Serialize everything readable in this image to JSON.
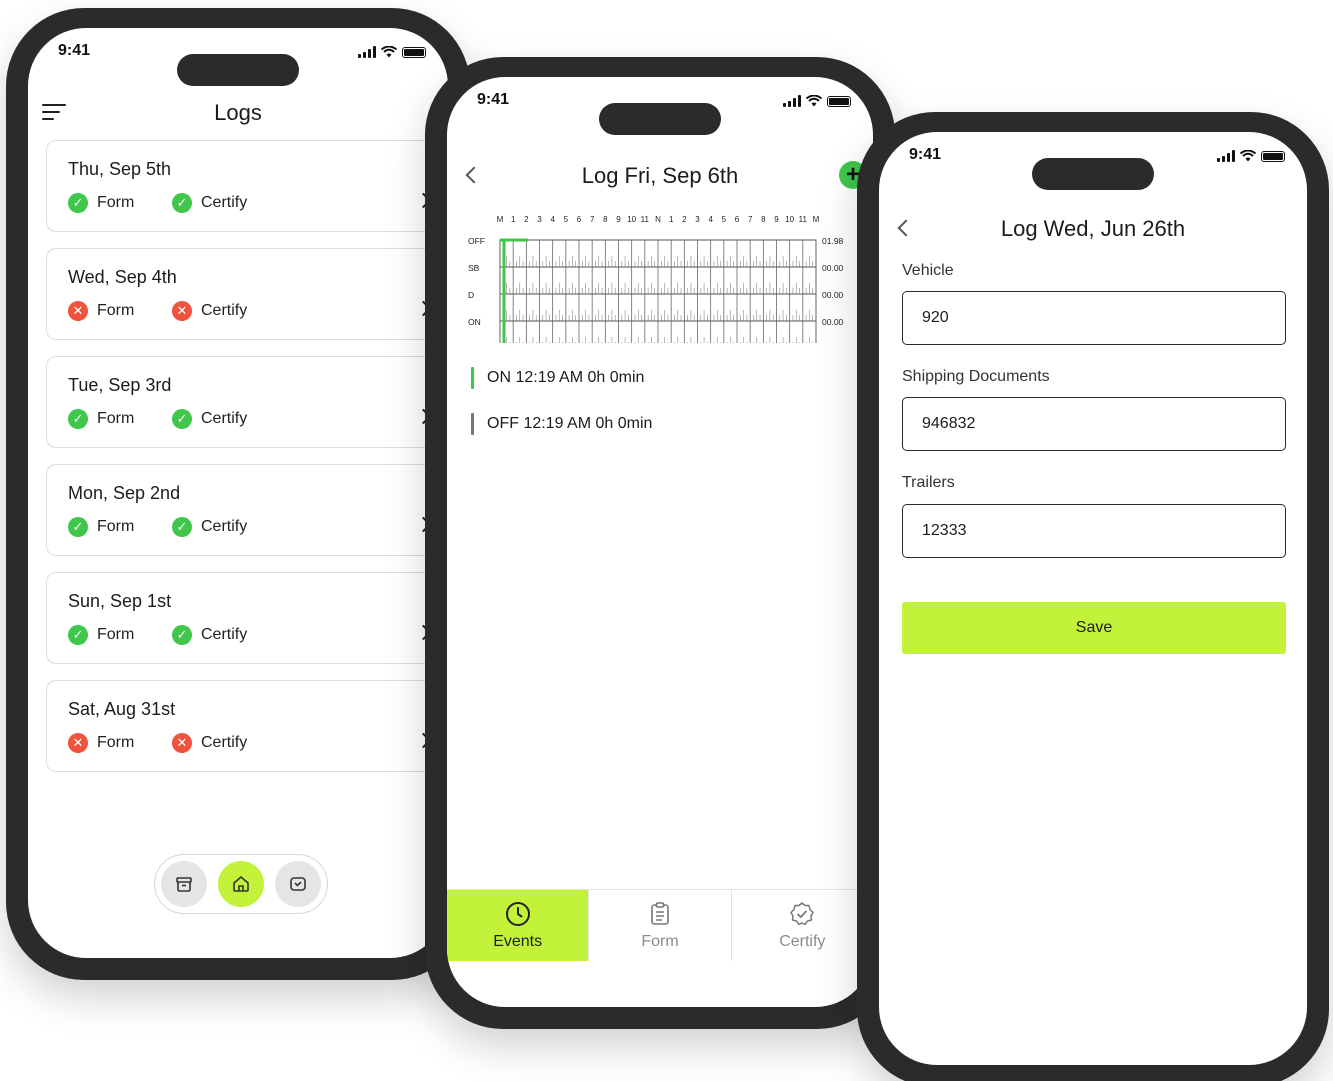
{
  "status_time": "9:41",
  "phone1": {
    "title": "Logs",
    "logs": [
      {
        "date": "Thu, Sep 5th",
        "form": "Form",
        "form_ok": true,
        "certify": "Certify",
        "certify_ok": true
      },
      {
        "date": "Wed, Sep 4th",
        "form": "Form",
        "form_ok": false,
        "certify": "Certify",
        "certify_ok": false
      },
      {
        "date": "Tue, Sep 3rd",
        "form": "Form",
        "form_ok": true,
        "certify": "Certify",
        "certify_ok": true
      },
      {
        "date": "Mon, Sep 2nd",
        "form": "Form",
        "form_ok": true,
        "certify": "Certify",
        "certify_ok": true
      },
      {
        "date": "Sun, Sep 1st",
        "form": "Form",
        "form_ok": true,
        "certify": "Certify",
        "certify_ok": true
      },
      {
        "date": "Sat, Aug 31st",
        "form": "Form",
        "form_ok": false,
        "certify": "Certify",
        "certify_ok": false
      }
    ],
    "dock": [
      {
        "icon": "archive-icon",
        "active": false
      },
      {
        "icon": "home-icon",
        "active": true
      },
      {
        "icon": "inbox-icon",
        "active": false
      }
    ]
  },
  "phone2": {
    "title": "Log Fri, Sep 6th",
    "chart": {
      "hours": [
        "M",
        "1",
        "2",
        "3",
        "4",
        "5",
        "6",
        "7",
        "8",
        "9",
        "10",
        "11",
        "N",
        "1",
        "2",
        "3",
        "4",
        "5",
        "6",
        "7",
        "8",
        "9",
        "10",
        "11",
        "M"
      ],
      "rows": [
        {
          "label": "OFF",
          "total": "01.98"
        },
        {
          "label": "SB",
          "total": "00.00"
        },
        {
          "label": "D",
          "total": "00.00"
        },
        {
          "label": "ON",
          "total": "00.00"
        }
      ]
    },
    "events": [
      {
        "text": "ON 12:19 AM 0h 0min",
        "color": "#3fc64b"
      },
      {
        "text": "OFF 12:19 AM 0h 0min",
        "color": "#777777"
      }
    ],
    "tabs": [
      {
        "label": "Events",
        "icon": "clock-icon",
        "active": true
      },
      {
        "label": "Form",
        "icon": "clipboard-icon",
        "active": false
      },
      {
        "label": "Certify",
        "icon": "badge-check-icon",
        "active": false
      }
    ]
  },
  "phone3": {
    "title": "Log Wed, Jun 26th",
    "fields": [
      {
        "label": "Vehicle",
        "value": "920"
      },
      {
        "label": "Shipping Documents",
        "value": "946832"
      },
      {
        "label": "Trailers",
        "value": "12333"
      }
    ],
    "save_label": "Save"
  },
  "colors": {
    "accent": "#c3f23a",
    "ok": "#3fc64b",
    "error": "#f0533d",
    "frame": "#2b2b2b"
  }
}
